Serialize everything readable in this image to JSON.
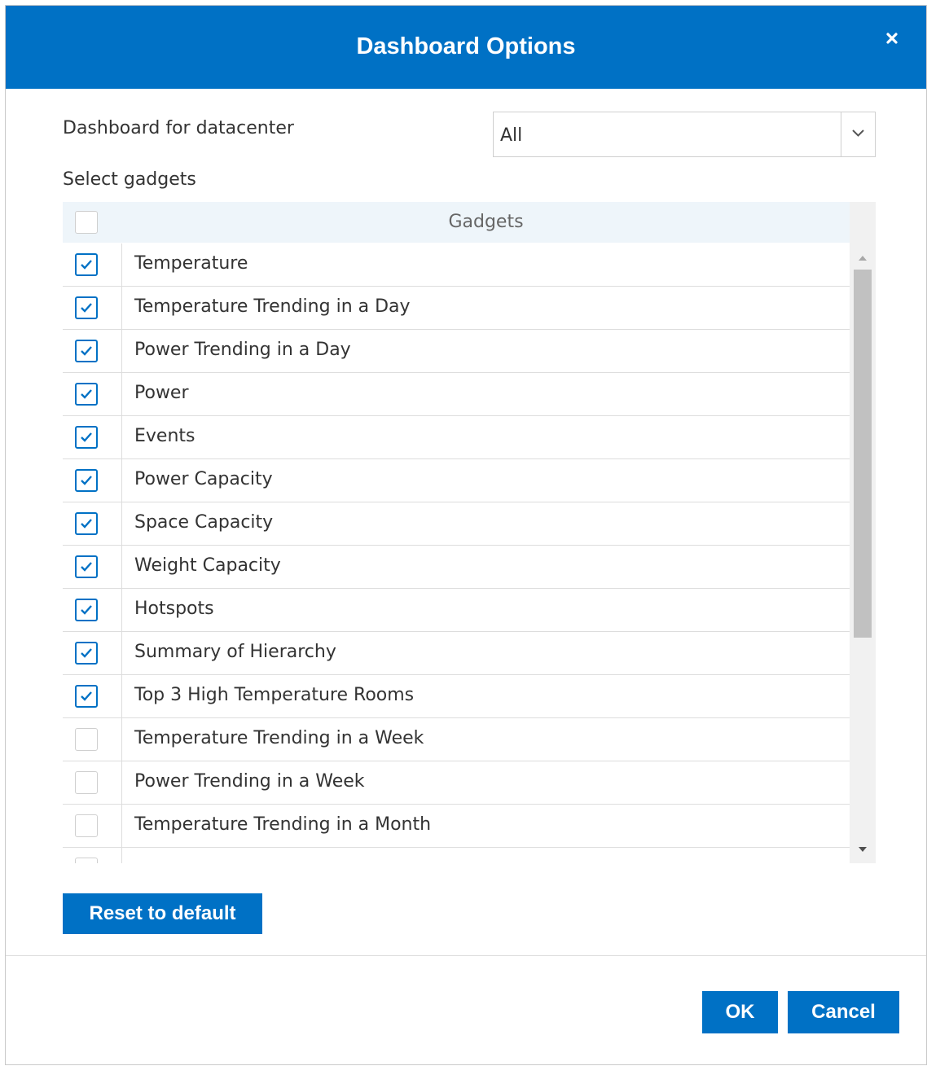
{
  "dialog": {
    "title": "Dashboard Options",
    "close_icon": "close-icon"
  },
  "datacenter": {
    "label": "Dashboard for datacenter",
    "selected": "All"
  },
  "gadgets": {
    "label": "Select gadgets",
    "column_header": "Gadgets",
    "select_all_checked": false,
    "items": [
      {
        "name": "Temperature",
        "checked": true
      },
      {
        "name": "Temperature Trending in a Day",
        "checked": true
      },
      {
        "name": "Power Trending in a Day",
        "checked": true
      },
      {
        "name": "Power",
        "checked": true
      },
      {
        "name": "Events",
        "checked": true
      },
      {
        "name": "Power Capacity",
        "checked": true
      },
      {
        "name": "Space Capacity",
        "checked": true
      },
      {
        "name": "Weight Capacity",
        "checked": true
      },
      {
        "name": "Hotspots",
        "checked": true
      },
      {
        "name": "Summary of Hierarchy",
        "checked": true
      },
      {
        "name": "Top 3 High Temperature Rooms",
        "checked": true
      },
      {
        "name": "Temperature Trending in a Week",
        "checked": false
      },
      {
        "name": "Power Trending in a Week",
        "checked": false
      },
      {
        "name": "Temperature Trending in a Month",
        "checked": false
      },
      {
        "name": "",
        "checked": false
      }
    ]
  },
  "buttons": {
    "reset": "Reset to default",
    "ok": "OK",
    "cancel": "Cancel"
  },
  "colors": {
    "accent": "#0071c5",
    "header_bg": "#eef5fa",
    "border": "#dddddd"
  }
}
